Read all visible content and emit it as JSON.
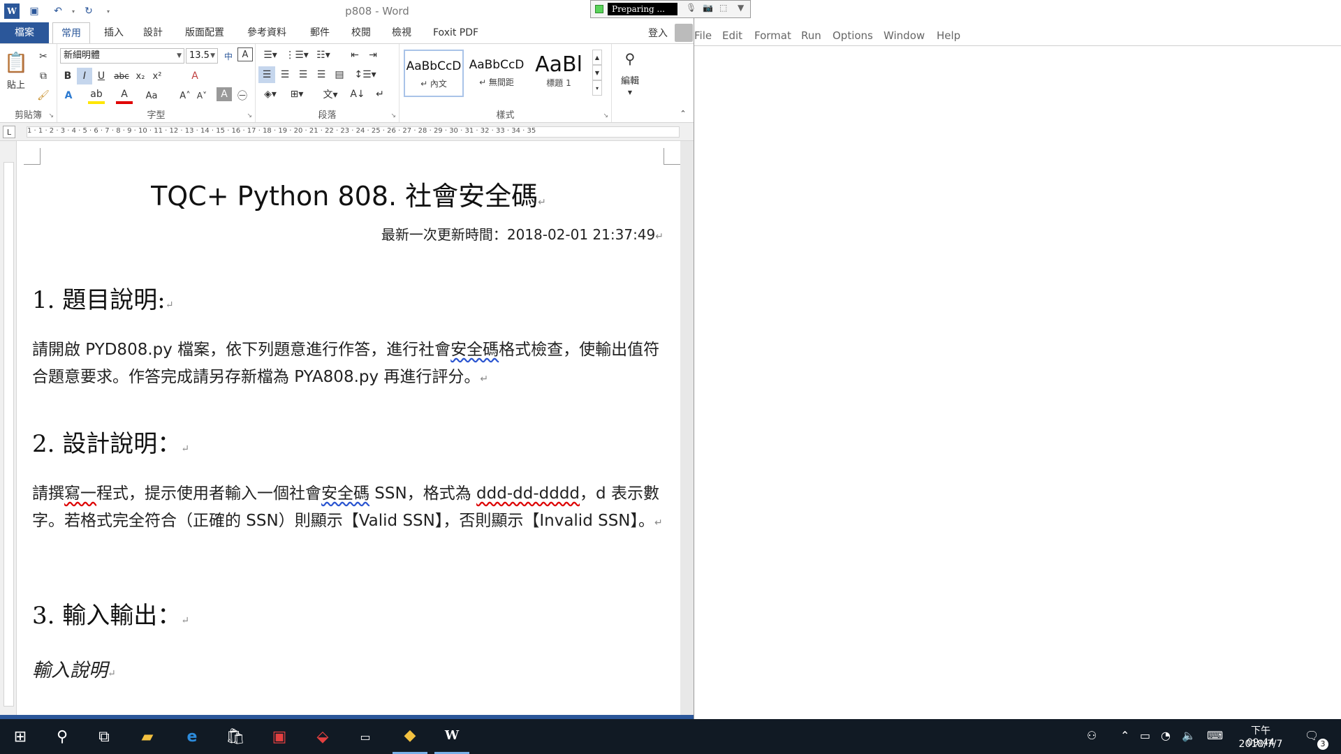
{
  "word": {
    "title": "p808 - Word",
    "file_tab": "檔案",
    "tabs": [
      "常用",
      "插入",
      "設計",
      "版面配置",
      "參考資料",
      "郵件",
      "校閱",
      "檢視",
      "Foxit PDF"
    ],
    "signin": "登入",
    "ribbon": {
      "paste_label": "貼上",
      "clipboard_group": "剪貼簿",
      "font_name": "新細明體",
      "font_size": "13.5",
      "font_group": "字型",
      "paragraph_group": "段落",
      "styles_group": "樣式",
      "styles": [
        {
          "sample": "AaBbCcD",
          "name": "↵ 內文"
        },
        {
          "sample": "AaBbCcD",
          "name": "↵ 無間距"
        },
        {
          "sample": "AaBl",
          "name": "標題 1"
        }
      ],
      "edit_label": "編輯"
    },
    "ruler_marks": "  1 · 1 · 2 · 3 · 4 · 5 · 6 · 7 · 8 · 9 · 10 · 11 · 12 · 13 · 14 · 15 · 16 · 17 · 18 · 19 · 20 · 21 · 22 · 23 · 24 · 25 · 26 · 27 · 28 · 29 · 30 · 31 · 32 · 33 · 34 · 35"
  },
  "document": {
    "title": "TQC+ Python 808.  社會安全碼",
    "updated": "最新一次更新時間：2018-02-01 21:37:49",
    "h1": "1.  題目說明:",
    "p1_a": "請開啟 PYD808.py 檔案，依下列題意進行作答，進行社會",
    "p1_squig": "安全碼",
    "p1_b": "格式檢查，使輸出值符合題意要求。作答完成請另存新檔為 PYA808.py 再進行評分。",
    "h2": "2.  設計說明：",
    "p2_a": "請撰",
    "p2_squig1": "寫一",
    "p2_b": "程式，提示使用者輸入一個社會",
    "p2_squig2": "安全碼",
    "p2_c": " SSN，格式為 ",
    "p2_squig3": "ddd-dd-dddd",
    "p2_d": "，d 表示數字。若格式完全符合（正確的 SSN）則顯示【Valid SSN】，否則顯示【Invalid SSN】。",
    "h3": "3.  輸入輸出：",
    "input_desc": "輸入說明"
  },
  "recorder": {
    "status": "Preparing ..."
  },
  "editor_menu": [
    "File",
    "Edit",
    "Format",
    "Run",
    "Options",
    "Window",
    "Help"
  ],
  "taskbar": {
    "time": "下午 09:44",
    "date": "2018/7/7",
    "notification_count": "3"
  }
}
